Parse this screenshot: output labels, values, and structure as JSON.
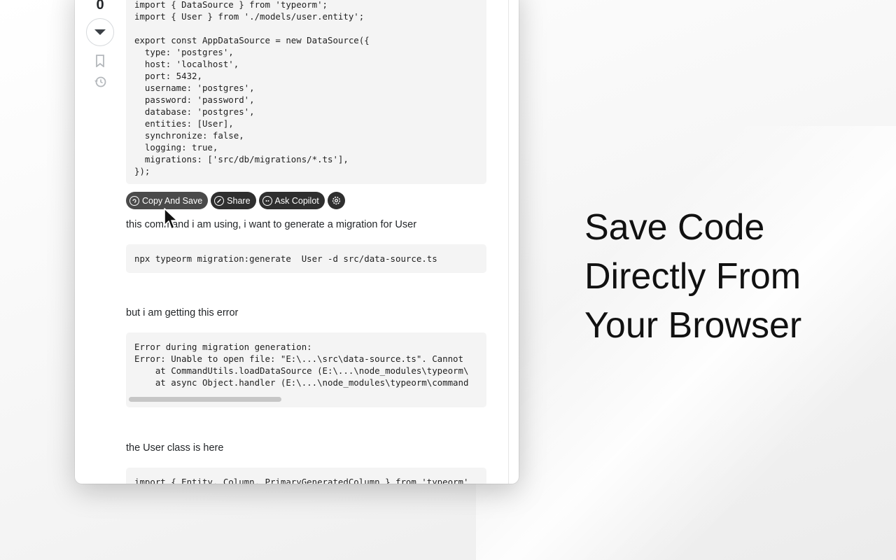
{
  "vote": {
    "count": "0"
  },
  "code_blocks": {
    "datasource": "import { DataSource } from 'typeorm';\nimport { User } from './models/user.entity';\n\nexport const AppDataSource = new DataSource({\n  type: 'postgres',\n  host: 'localhost',\n  port: 5432,\n  username: 'postgres',\n  password: 'password',\n  database: 'postgres',\n  entities: [User],\n  synchronize: false,\n  logging: true,\n  migrations: ['src/db/migrations/*.ts'],\n});",
    "command": "npx typeorm migration:generate  User -d src/data-source.ts",
    "error": "Error during migration generation:\nError: Unable to open file: \"E:\\...\\src\\data-source.ts\". Cannot\n    at CommandUtils.loadDataSource (E:\\...\\node_modules\\typeorm\\\n    at async Object.handler (E:\\...\\node_modules\\typeorm\\command",
    "entity": "import { Entity, Column, PrimaryGeneratedColumn } from 'typeorm'"
  },
  "toolbar": {
    "copy_save": "Copy And Save",
    "share": "Share",
    "ask_copilot": "Ask Copilot"
  },
  "paragraphs": {
    "p1": "this command i am using, i want to generate a migration for User",
    "p2": "but i am getting this error",
    "p3": "the User class is here"
  },
  "headline": {
    "line1": "Save Code",
    "line2": "Directly From",
    "line3": "Your Browser"
  },
  "icons": {
    "vote_down": "caret-down-icon",
    "bookmark": "bookmark-icon",
    "history": "history-icon",
    "copy_save": "save-icon",
    "share": "link-icon",
    "ask_copilot": "copilot-icon",
    "settings": "gear-icon",
    "cursor": "mouse-pointer-icon"
  }
}
